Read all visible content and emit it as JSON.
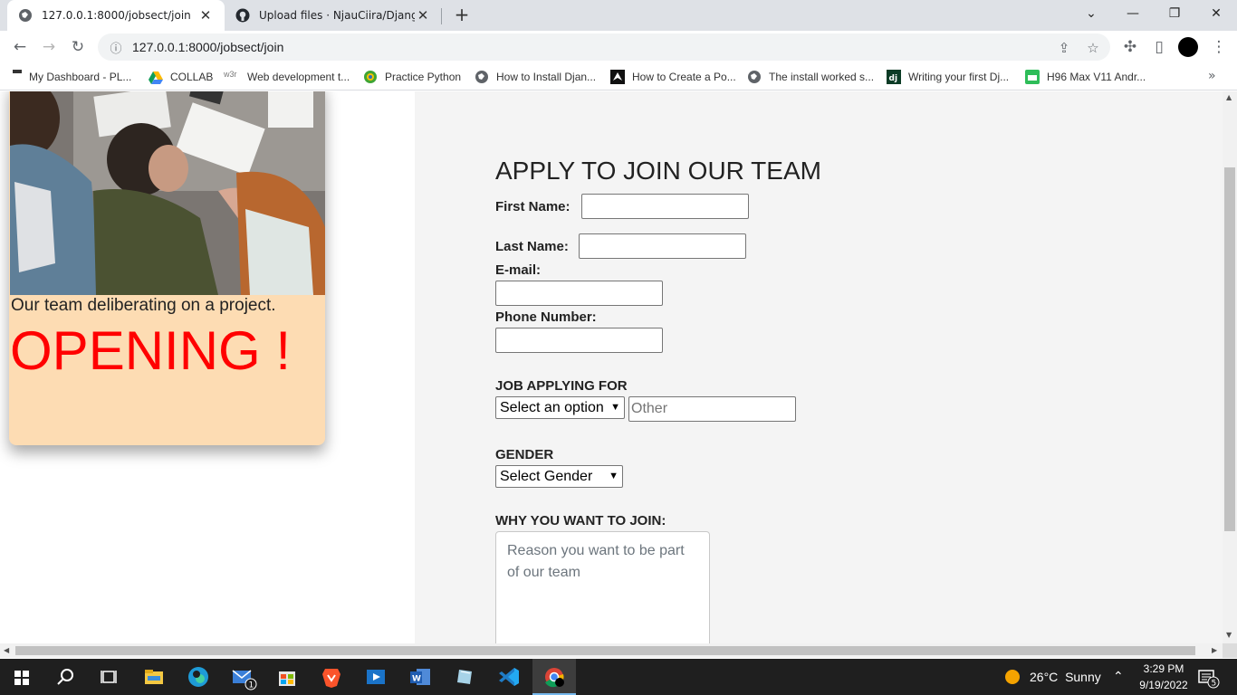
{
  "browser": {
    "tabs": [
      {
        "title": "127.0.0.1:8000/jobsect/join",
        "active": true
      },
      {
        "title": "Upload files · NjauCiira/Django_C",
        "active": false
      }
    ],
    "url": "127.0.0.1:8000/jobsect/join",
    "bookmarks": [
      {
        "label": "My Dashboard - PL...",
        "icon": "bookmark-icon"
      },
      {
        "label": "COLLAB",
        "icon": "google-drive-icon"
      },
      {
        "label": "Web development t...",
        "icon": "w3schools-icon"
      },
      {
        "label": "Practice Python",
        "icon": "practice-python-icon"
      },
      {
        "label": "How to Install Djan...",
        "icon": "globe-icon"
      },
      {
        "label": "How to Create a Po...",
        "icon": "arrow-logo-icon"
      },
      {
        "label": "The install worked s...",
        "icon": "globe-icon"
      },
      {
        "label": "Writing your first Dj...",
        "icon": "django-icon"
      },
      {
        "label": "H96 Max V11 Andr...",
        "icon": "store-icon"
      }
    ]
  },
  "card": {
    "caption": "Our team deliberating on a project.",
    "headline": "OPENING !"
  },
  "form": {
    "title": "APPLY TO JOIN OUR TEAM",
    "first_name_label": "First Name:",
    "last_name_label": "Last Name:",
    "email_label": "E-mail:",
    "phone_label": "Phone Number:",
    "job_label": "JOB APPLYING FOR",
    "job_select": "Select an option",
    "other_placeholder": "Other",
    "gender_label": "GENDER",
    "gender_select": "Select Gender",
    "why_label": "WHY YOU WANT TO JOIN:",
    "why_placeholder": "Reason you want to be part of our team"
  },
  "taskbar": {
    "weather_temp": "26°C",
    "weather_text": "Sunny",
    "time": "3:29 PM",
    "date": "9/19/2022",
    "notification_count": "5",
    "mail_badge": "1"
  },
  "colors": {
    "card_bg": "#fddcb3",
    "headline": "#ff0000",
    "form_panel_bg": "#f4f4f4",
    "taskbar_bg": "#1f1f1f"
  }
}
